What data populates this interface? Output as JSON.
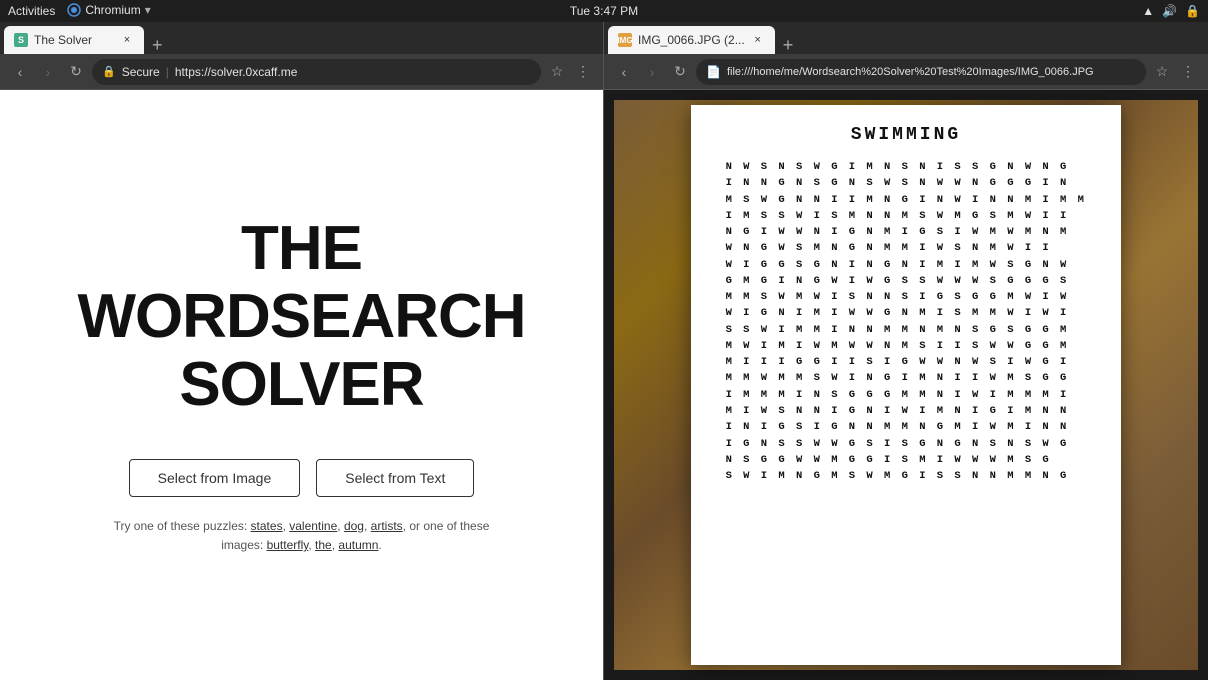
{
  "system": {
    "time": "Tue  3:47 PM",
    "activities": "Activities",
    "browser_name": "Chromium"
  },
  "left_browser": {
    "tab": {
      "favicon_letter": "S",
      "title": "The Solver",
      "close": "×"
    },
    "nav": {
      "back_btn": "‹",
      "forward_btn": "›",
      "reload_btn": "↻",
      "lock_label": "Secure",
      "url": "https://solver.0xcaff.me",
      "bookmark_icon": "☆",
      "menu_icon": "⋮"
    },
    "page": {
      "title_line1": "THE",
      "title_line2": "WORDSEARCH",
      "title_line3": "SOLVER",
      "btn_image": "Select from Image",
      "btn_text": "Select from Text",
      "hint_prefix": "Try one of these puzzles:",
      "hint_puzzles": "states, valentine, dog, artists,",
      "hint_image_prefix": "or one of these images:",
      "hint_images": "butterfly, the, autumn."
    }
  },
  "right_browser": {
    "tab": {
      "title": "IMG_0066.JPG (2...",
      "close": "×"
    },
    "nav": {
      "back_btn": "‹",
      "forward_btn": "›",
      "reload_btn": "↻",
      "url": "file:///home/me/Wordsearch%20Solver%20Test%20Images/IMG_0066.JPG",
      "bookmark_icon": "☆",
      "menu_icon": "⋮"
    },
    "image": {
      "puzzle_title": "SWIMMING",
      "grid_rows": [
        "N W S N S W G I M N S N I S S G N W N G",
        "I N N G N S G N S W S N W W N G G G I N",
        "M S W G N N I I M N G I N W I N N M I M M",
        "I M S S W I S M N N M S W M G S M W I I",
        "N G I W W N I G N M I G S I W M W M N M",
        "W N G W S M N G N M M I W S N M W I I",
        "W I G G S G N I N G N I M I M W S G N W",
        "G M G I N G W I W G S S W W W S G G G S",
        "M M S W M W I S N N S I G S G G M W I W",
        "W I G N I M I W W G N M I S M M W I W I",
        "S S W I M M I N N M M N M N S G S G G M",
        "M W I M I W M W W N M S I I S W W G G M",
        "M I I I G G I I S I G W W N W S I W G I",
        "M M W M M S W I N G I M N I I W M S G G",
        "I M M M I N S G G G M M N I W I M M M I",
        "M I W S N N I G N I W I M N I G I M N N",
        "I N I G S I G N N M M N G M I W M I N N",
        "I G N S S W W G S I S G N G N S N S W G",
        "N S G G W W M G G I S M I W W W M S G",
        "S W I M N G M S W M G I S S N N M M N G"
      ]
    }
  }
}
